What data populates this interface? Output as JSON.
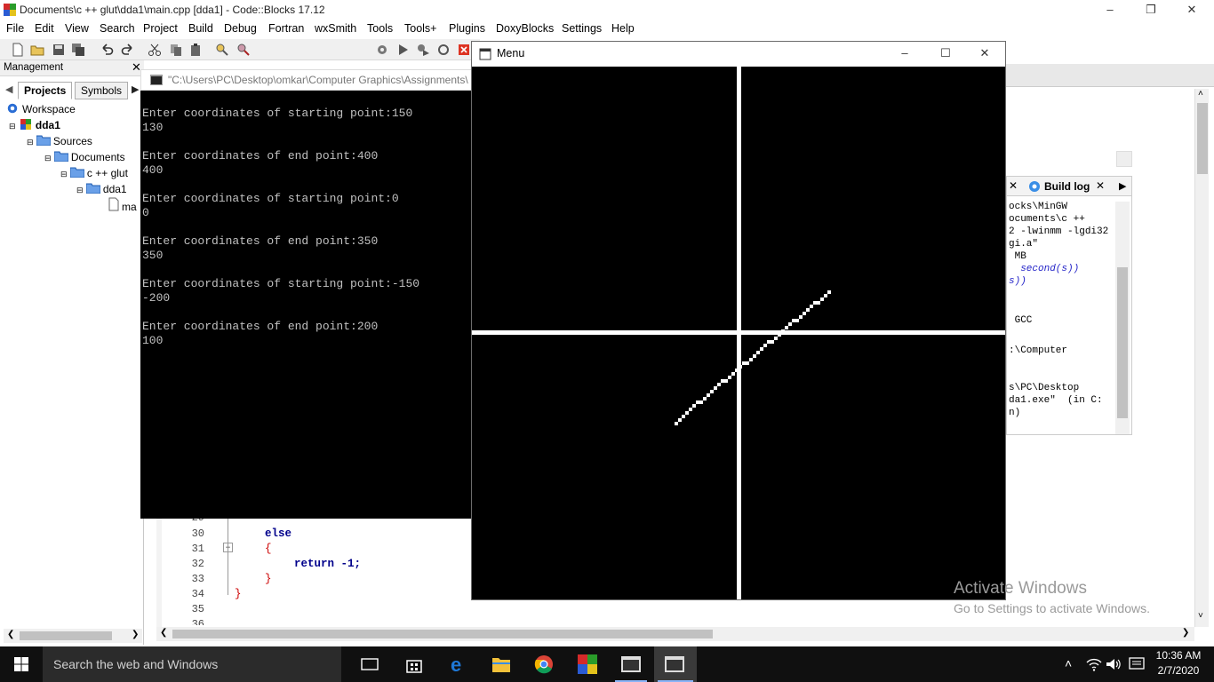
{
  "window": {
    "title": "Documents\\c ++ glut\\dda1\\main.cpp [dda1] - Code::Blocks 17.12"
  },
  "menubar": [
    "File",
    "Edit",
    "View",
    "Search",
    "Project",
    "Build",
    "Debug",
    "Fortran",
    "wxSmith",
    "Tools",
    "Tools+",
    "Plugins",
    "DoxyBlocks",
    "Settings",
    "Help"
  ],
  "management": {
    "title": "Management",
    "tabs": [
      "Projects",
      "Symbols"
    ],
    "tree": [
      "Workspace",
      "dda1",
      "Sources",
      "Documents",
      "c ++ glut",
      "dda1",
      "ma"
    ]
  },
  "console": {
    "title": "\"C:\\Users\\PC\\Desktop\\omkar\\Computer Graphics\\Assignments\\",
    "lines": [
      "Enter coordinates of starting point:150",
      "130",
      "",
      "Enter coordinates of end point:400",
      "400",
      "",
      "Enter coordinates of starting point:0",
      "0",
      "",
      "Enter coordinates of end point:350",
      "350",
      "",
      "Enter coordinates of starting point:-150",
      "-200",
      "",
      "Enter coordinates of end point:200",
      "100"
    ]
  },
  "glut_window": {
    "title": "Menu"
  },
  "editor": {
    "lines": [
      {
        "num": "29",
        "code": ""
      },
      {
        "num": "30",
        "code": "else"
      },
      {
        "num": "31",
        "code": "{"
      },
      {
        "num": "32",
        "code": "return -1;"
      },
      {
        "num": "33",
        "code": "}"
      },
      {
        "num": "34",
        "code": "}"
      },
      {
        "num": "35",
        "code": ""
      },
      {
        "num": "36",
        "code": ""
      }
    ]
  },
  "build_log": {
    "tab_label": "Build log",
    "lines": [
      "ocks\\MinGW",
      "ocuments\\c ++",
      "2 -lwinmm -lgdi32",
      "gi.a\"",
      " MB",
      "  second(s))",
      "s))",
      "",
      " GCC",
      "",
      ":\\Computer",
      "",
      "s\\PC\\Desktop",
      "da1.exe\"  (in C:",
      "n)"
    ]
  },
  "watermark": {
    "line1": "Activate Windows",
    "line2": "Go to Settings to activate Windows."
  },
  "taskbar": {
    "search_placeholder": "Search the web and Windows",
    "time": "10:36 AM",
    "date": "2/7/2020"
  }
}
